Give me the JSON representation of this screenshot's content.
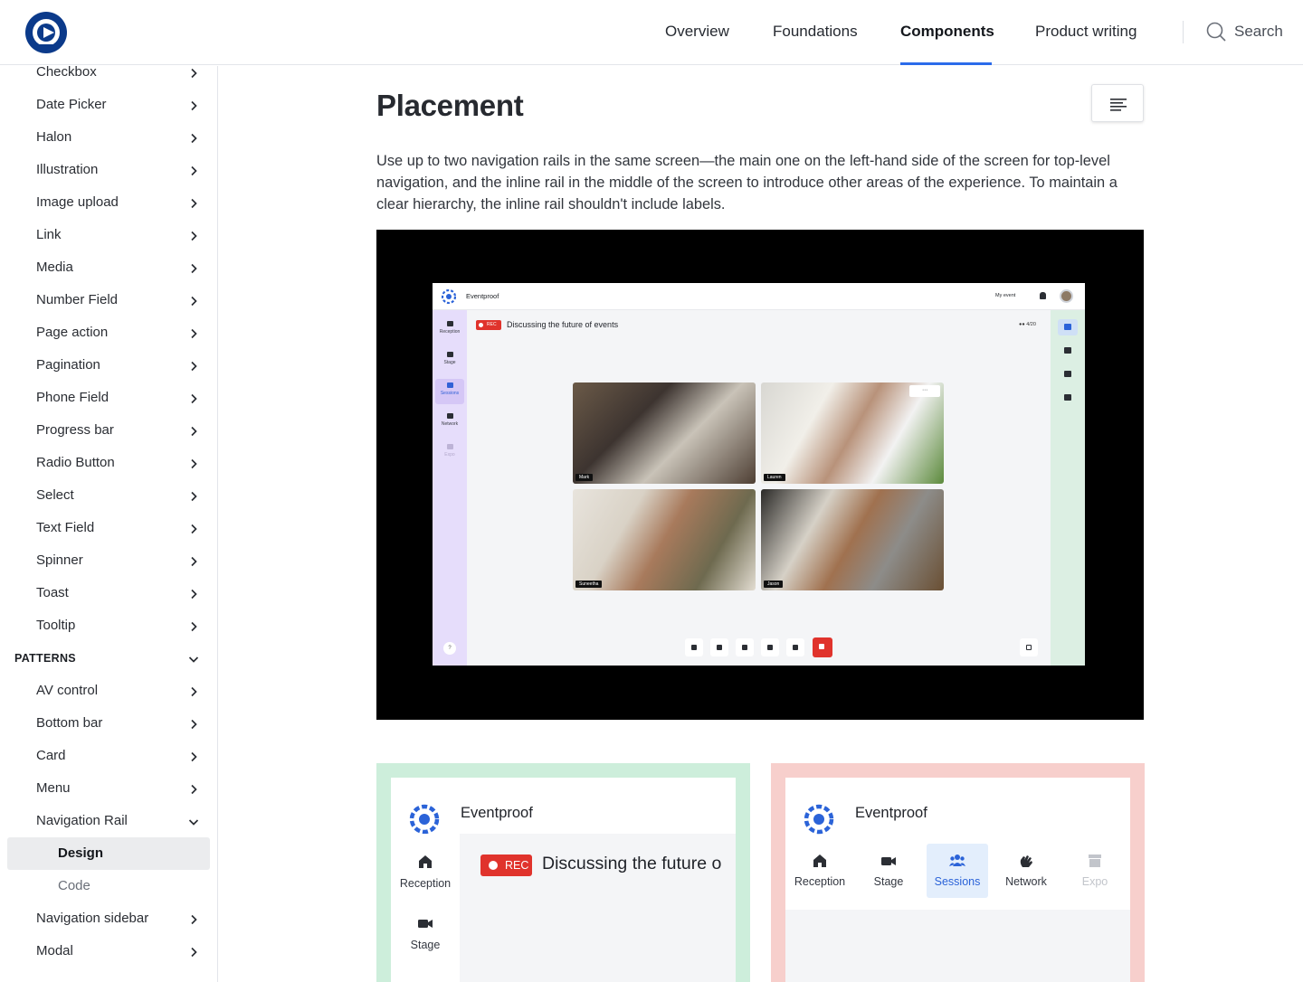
{
  "header": {
    "nav": [
      {
        "label": "Overview"
      },
      {
        "label": "Foundations"
      },
      {
        "label": "Components"
      },
      {
        "label": "Product writing"
      }
    ],
    "search_label": "Search"
  },
  "sidebar": {
    "items": [
      {
        "label": "Checkbox",
        "type": "item"
      },
      {
        "label": "Date Picker",
        "type": "item"
      },
      {
        "label": "Halon",
        "type": "item"
      },
      {
        "label": "Illustration",
        "type": "item"
      },
      {
        "label": "Image upload",
        "type": "item"
      },
      {
        "label": "Link",
        "type": "item"
      },
      {
        "label": "Media",
        "type": "item"
      },
      {
        "label": "Number Field",
        "type": "item"
      },
      {
        "label": "Page action",
        "type": "item"
      },
      {
        "label": "Pagination",
        "type": "item"
      },
      {
        "label": "Phone Field",
        "type": "item"
      },
      {
        "label": "Progress bar",
        "type": "item"
      },
      {
        "label": "Radio Button",
        "type": "item"
      },
      {
        "label": "Select",
        "type": "item"
      },
      {
        "label": "Text Field",
        "type": "item"
      },
      {
        "label": "Spinner",
        "type": "item"
      },
      {
        "label": "Toast",
        "type": "item"
      },
      {
        "label": "Tooltip",
        "type": "item"
      },
      {
        "label": "PATTERNS",
        "type": "section"
      },
      {
        "label": "AV control",
        "type": "item"
      },
      {
        "label": "Bottom bar",
        "type": "item"
      },
      {
        "label": "Card",
        "type": "item"
      },
      {
        "label": "Menu",
        "type": "item"
      },
      {
        "label": "Navigation Rail",
        "type": "open"
      },
      {
        "label": "Design",
        "type": "sub-active"
      },
      {
        "label": "Code",
        "type": "sub"
      },
      {
        "label": "Navigation sidebar",
        "type": "item"
      },
      {
        "label": "Modal",
        "type": "item"
      }
    ]
  },
  "main": {
    "title": "Placement",
    "intro": "Use up to two navigation rails in the same screen—the main one on the left-hand side of the screen for top-level navigation, and the inline rail in the middle of the screen to introduce other areas of the experience. To maintain a clear hierarchy, the inline rail shouldn't include labels."
  },
  "preview": {
    "app_name": "Eventproof",
    "event_label": "My event",
    "rec": "REC",
    "session_title": "Discussing the future of events",
    "attendees": "4/20",
    "rail": [
      "Reception",
      "Stage",
      "Sessions",
      "Network",
      "Expo"
    ],
    "participants": [
      "Mark",
      "Lauren",
      "Suneetha",
      "Jason"
    ],
    "help": "?"
  },
  "card_green": {
    "brand": "Eventproof",
    "rec": "REC",
    "session_title": "Discussing the future o",
    "rail": [
      "Reception",
      "Stage"
    ]
  },
  "card_red": {
    "brand": "Eventproof",
    "tabs": [
      "Reception",
      "Stage",
      "Sessions",
      "Network",
      "Expo"
    ]
  },
  "colors": {
    "accent": "#2b6bea",
    "rec": "#e0332c",
    "rail_purple": "#e6ddfb",
    "rail_green": "#dcefe3",
    "card_green": "#cdeedb",
    "card_red": "#f7cfcc"
  }
}
